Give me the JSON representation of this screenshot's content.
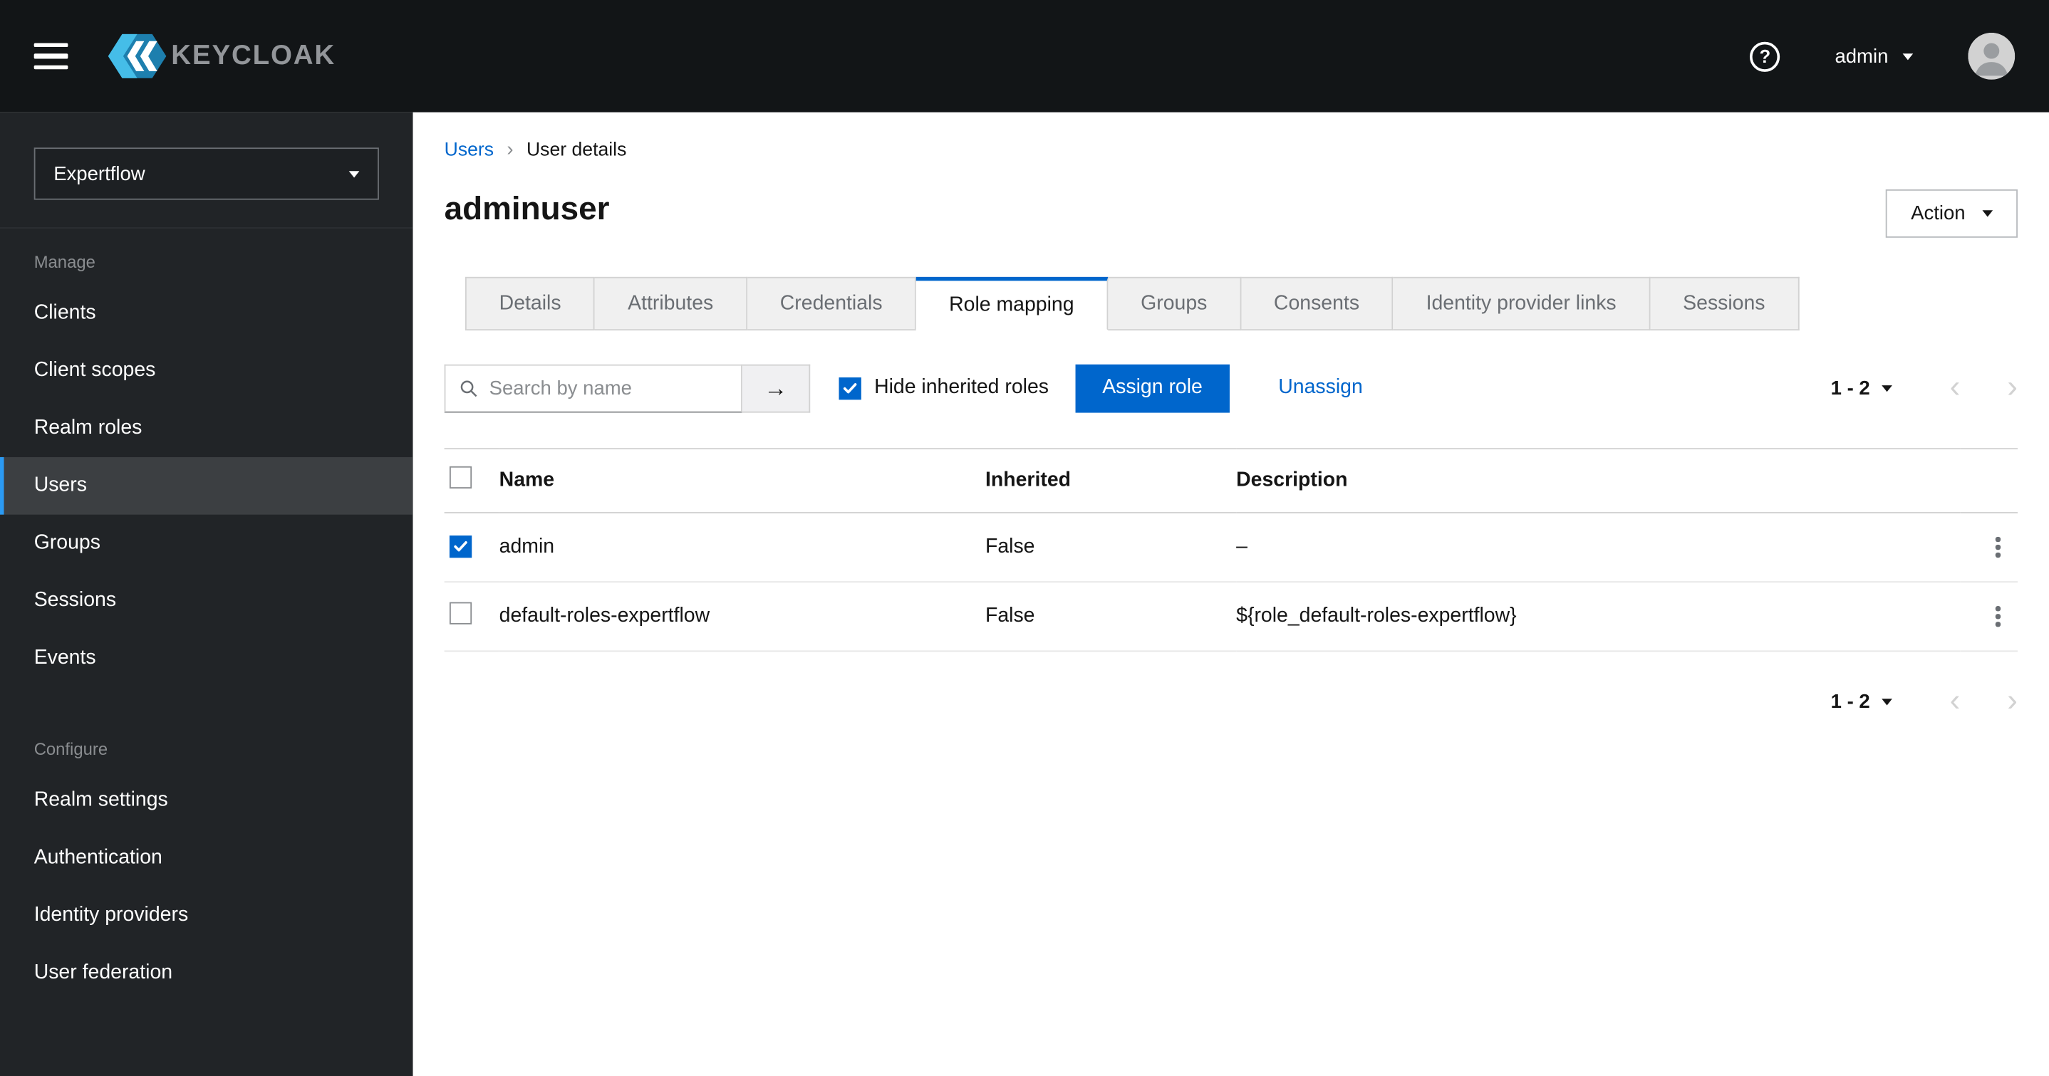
{
  "colors": {
    "primary": "#0066cc",
    "link": "#0066cc",
    "header_bg": "#121517",
    "sidebar_bg": "#212427",
    "nav_active_bg": "#3c3f42",
    "nav_active_accent": "#2b9af3",
    "checkbox_checked": "#0066cc"
  },
  "header": {
    "brand": "KEYCLOAK",
    "help_icon": "?",
    "user": {
      "label": "admin"
    }
  },
  "sidebar": {
    "realm_selector": {
      "value": "Expertflow"
    },
    "sections": [
      {
        "label": "Manage",
        "items": [
          {
            "label": "Clients",
            "active": false
          },
          {
            "label": "Client scopes",
            "active": false
          },
          {
            "label": "Realm roles",
            "active": false
          },
          {
            "label": "Users",
            "active": true
          },
          {
            "label": "Groups",
            "active": false
          },
          {
            "label": "Sessions",
            "active": false
          },
          {
            "label": "Events",
            "active": false
          }
        ]
      },
      {
        "label": "Configure",
        "items": [
          {
            "label": "Realm settings",
            "active": false
          },
          {
            "label": "Authentication",
            "active": false
          },
          {
            "label": "Identity providers",
            "active": false
          },
          {
            "label": "User federation",
            "active": false
          }
        ]
      }
    ]
  },
  "main": {
    "breadcrumb": {
      "root": "Users",
      "separator": "›",
      "current": "User details"
    },
    "page_title": "adminuser",
    "action_button": "Action",
    "tabs": [
      {
        "label": "Details",
        "active": false
      },
      {
        "label": "Attributes",
        "active": false
      },
      {
        "label": "Credentials",
        "active": false
      },
      {
        "label": "Role mapping",
        "active": true
      },
      {
        "label": "Groups",
        "active": false
      },
      {
        "label": "Consents",
        "active": false
      },
      {
        "label": "Identity provider links",
        "active": false
      },
      {
        "label": "Sessions",
        "active": false
      }
    ],
    "toolbar": {
      "search_placeholder": "Search by name",
      "search_submit_icon": "→",
      "hide_inherited": {
        "label": "Hide inherited roles",
        "checked": true
      },
      "assign_role": "Assign role",
      "unassign": "Unassign",
      "pagination": {
        "range": "1 - 2",
        "prev_icon": "‹",
        "next_icon": "›"
      }
    },
    "table": {
      "columns": [
        "Name",
        "Inherited",
        "Description"
      ],
      "rows": [
        {
          "checked": true,
          "name": "admin",
          "inherited": "False",
          "description": "–"
        },
        {
          "checked": false,
          "name": "default-roles-expertflow",
          "inherited": "False",
          "description": "${role_default-roles-expertflow}"
        }
      ]
    },
    "footer_pagination": {
      "range": "1 - 2",
      "prev_icon": "‹",
      "next_icon": "›"
    }
  }
}
